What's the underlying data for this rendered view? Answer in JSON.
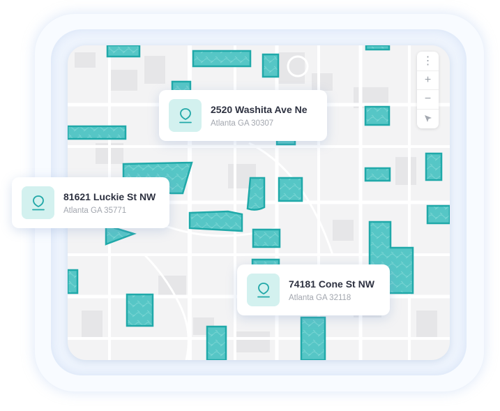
{
  "locations": [
    {
      "address": "2520 Washita Ave Ne",
      "city": "Atlanta GA 30307"
    },
    {
      "address": "81621 Luckie St NW",
      "city": "Atlanta GA 35771"
    },
    {
      "address": "74181 Cone St NW",
      "city": "Atlanta GA 32118"
    }
  ],
  "map_controls": [
    {
      "label": "⋮",
      "icon": "more-options-icon"
    },
    {
      "label": "+",
      "icon": "zoom-in-icon"
    },
    {
      "label": "−",
      "icon": "zoom-out-icon"
    },
    {
      "label": "",
      "icon": "locate-arrow-icon"
    }
  ],
  "colors": {
    "parcel_fill": "#4fc3c3",
    "parcel_stroke": "#1fa8a8",
    "map_background": "#f3f3f4",
    "pin_background": "#d3f1ef",
    "pin_stroke": "#22a8a8"
  }
}
